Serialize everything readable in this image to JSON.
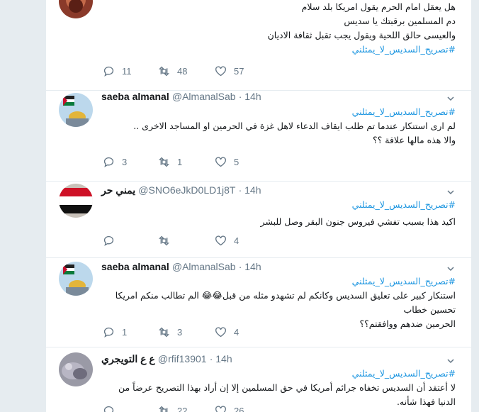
{
  "tweets": [
    {
      "lines": [
        "هل يعقل امام الحرم يقول امريكا بلد سلام",
        "دم المسلمين برقبتك يا سديس",
        "والعيسى حالق اللحية ويقول يجب تقبل ثقافة الاديان"
      ],
      "hashtag": "#تصريح_السديس_لا_يمثلني",
      "replies": "11",
      "retweets": "48",
      "likes": "57"
    },
    {
      "name": "saeba almanal",
      "handle": "@AlmanalSab",
      "time": "· 14h",
      "hashtag": "#تصريح_السديس_لا_يمثلني",
      "lines": [
        "لم ارى استنكار عندما تم طلب ايقاف الدعاء لاهل غزة في الحرمين او المساجد الاخرى ..",
        "والا هذه مالها علاقة ؟؟"
      ],
      "replies": "3",
      "retweets": "1",
      "likes": "5"
    },
    {
      "name": "يمني حر",
      "handle": "@SNO6eJkD0LD1j8T",
      "time": "· 14h",
      "hashtag": "#تصريح_السديس_لا_يمثلني",
      "lines": [
        "اكيد هذا بسبب تفشي فيروس جنون البقر وصل للبشر"
      ],
      "replies": "",
      "retweets": "",
      "likes": "4"
    },
    {
      "name": "saeba almanal",
      "handle": "@AlmanalSab",
      "time": "· 14h",
      "hashtag": "#تصريح_السديس_لا_يمثلني",
      "lines": [
        "استنكار كبير على تعليق السديس وكانكم لم تشهدو مثله من قبل😂😂 الم تطالب منكم امريكا تحسين خطاب",
        "الحرمين ضدهم ووافقتم؟؟"
      ],
      "replies": "1",
      "retweets": "3",
      "likes": "4"
    },
    {
      "name": "ع ع التويجري",
      "handle": "@rfif13901",
      "time": "· 14h",
      "hashtag": "#تصريح_السديس_لا_يمثلني",
      "lines": [
        "لا أعتقد أن السديس تخفاه جرائم أمريكا في حق المسلمين إلا إن أراد بهذا التصريح عرضاً من الدنيا فهذا شأنه."
      ],
      "replies": "",
      "retweets": "22",
      "likes": "26"
    }
  ],
  "colors": {
    "link": "#1b95e0",
    "meta": "#657786",
    "border": "#e6ecf0"
  },
  "icons": {
    "reply": "reply-icon",
    "retweet": "retweet-icon",
    "like": "heart-icon",
    "caret": "chevron-down-icon"
  }
}
